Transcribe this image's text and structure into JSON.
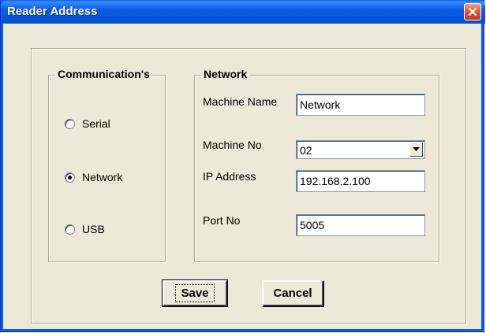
{
  "window": {
    "title": "Reader Address",
    "accent_color": "#0a5ee8",
    "close_icon": "close-icon"
  },
  "communications": {
    "legend": "Communication's",
    "options": [
      {
        "label": "Serial",
        "selected": false
      },
      {
        "label": "Network",
        "selected": true
      },
      {
        "label": "USB",
        "selected": false
      }
    ]
  },
  "network": {
    "legend": "Network",
    "machine_name_label": "Machine Name",
    "machine_name_value": "Network",
    "machine_no_label": "Machine No",
    "machine_no_value": "02",
    "ip_address_label": "IP Address",
    "ip_address_value": "192.168.2.100",
    "port_no_label": "Port No",
    "port_no_value": "5005"
  },
  "buttons": {
    "save_label": "Save",
    "cancel_label": "Cancel"
  }
}
